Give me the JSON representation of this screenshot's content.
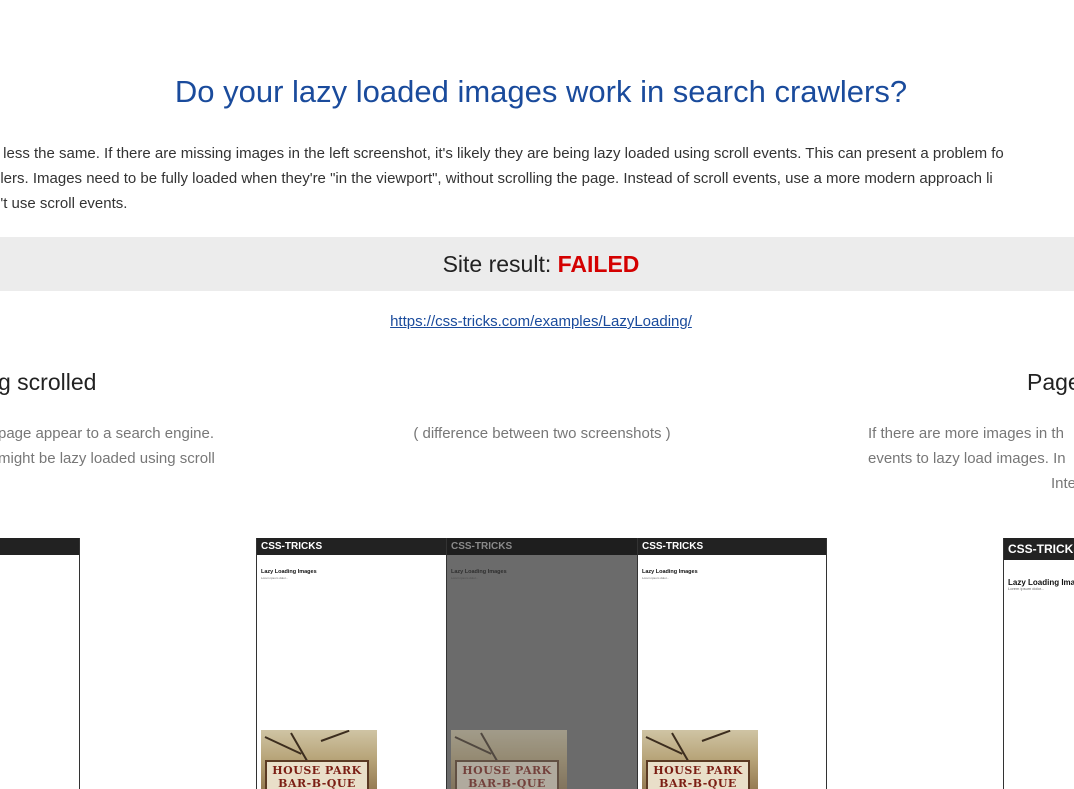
{
  "title": "Do your lazy loaded images work in search crawlers?",
  "intro": {
    "line1": "r less the same. If there are missing images in the left screenshot, it's likely they are being lazy loaded using scroll events. This can present a problem fo",
    "line2": "dlers. Images need to be fully loaded when they're \"in the viewport\", without scrolling the page. Instead of scroll events, use a more modern approach li",
    "line3": "n't use scroll events."
  },
  "result": {
    "label": "Site result: ",
    "status": "FAILED",
    "status_color": "#d40000"
  },
  "url": "https://css-tricks.com/examples/LazyLoading/",
  "columns": {
    "left": {
      "heading": "g scrolled",
      "desc_line1": "page appear to a search engine.",
      "desc_line2": "might be lazy loaded using scroll"
    },
    "center": {
      "desc": "( difference between two screenshots )"
    },
    "right": {
      "heading": "Page",
      "desc_line1": "If there are more images in th",
      "desc_line2": "events to lazy load images. In",
      "desc_line3": "Inte"
    }
  },
  "screenshot": {
    "site_name": "CSS-TRICKS",
    "page_title": "Lazy Loading Images",
    "page_sub": "Lorem ipsum dolor...",
    "sign_line1": "HOUSE PARK",
    "sign_line2": "BAR-B-QUE",
    "sign_line1_diff": "HOUSE PARK",
    "sign_line2_diff": "BAR-B-QUE"
  },
  "colors": {
    "title": "#1a4b9c",
    "link": "#1a4b9c",
    "result_bar": "#ececec",
    "diff_bg": "#6b6b6b"
  }
}
